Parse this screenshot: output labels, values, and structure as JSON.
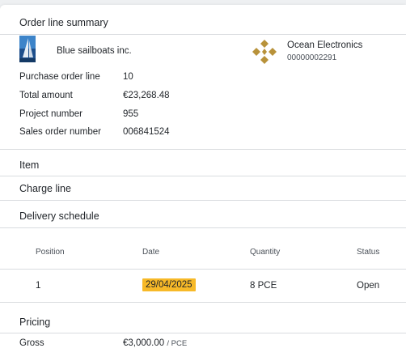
{
  "summary": {
    "title": "Order line summary",
    "vendor_name": "Blue sailboats inc.",
    "customer_name": "Ocean Electronics",
    "customer_id": "00000002291",
    "rows": [
      {
        "label": "Purchase order line",
        "value": "10"
      },
      {
        "label": "Total amount",
        "value": "€23,268.48"
      },
      {
        "label": "Project number",
        "value": "955"
      },
      {
        "label": "Sales order number",
        "value": "006841524"
      }
    ]
  },
  "sections": {
    "item": "Item",
    "charge_line": "Charge line",
    "delivery_schedule": "Delivery schedule",
    "pricing": "Pricing"
  },
  "schedule": {
    "headers": {
      "position": "Position",
      "date": "Date",
      "quantity": "Quantity",
      "status": "Status"
    },
    "rows": [
      {
        "position": "1",
        "date": "29/04/2025",
        "quantity": "8 PCE",
        "status": "Open"
      }
    ]
  },
  "pricing": {
    "gross_label": "Gross",
    "gross_value": "€3,000.00",
    "gross_unit": "/ PCE"
  },
  "colors": {
    "date_highlight": "#f7b928",
    "customer_logo": "#b8923a",
    "vendor_logo": "#2f6fb5"
  },
  "icons": {
    "vendor_logo": "sailboat-logo-icon",
    "customer_logo": "diamond-cluster-logo-icon"
  }
}
